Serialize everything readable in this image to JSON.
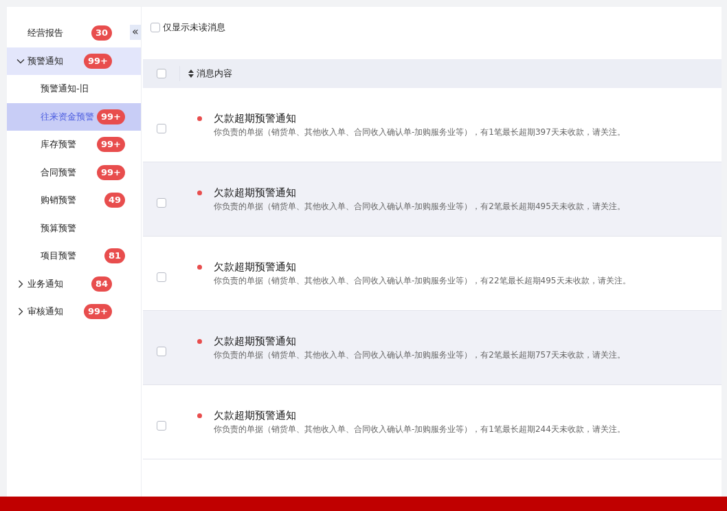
{
  "sidebar": {
    "collapse_icon": "«",
    "items": [
      {
        "kind": "leaf",
        "label": "经营报告",
        "badge": "30",
        "selected": false
      },
      {
        "kind": "group",
        "label": "预警通知",
        "badge": "99+",
        "selected": false,
        "expanded": true,
        "children": [
          {
            "label": "预警通知-旧",
            "selected": false
          },
          {
            "label": "往来资金预警",
            "badge": "99+",
            "selected": true
          },
          {
            "label": "库存预警",
            "badge": "99+",
            "selected": false
          },
          {
            "label": "合同预警",
            "badge": "99+",
            "selected": false
          },
          {
            "label": "购销预警",
            "badge": "49",
            "selected": false
          },
          {
            "label": "预算预警",
            "selected": false
          },
          {
            "label": "项目预警",
            "badge": "81",
            "selected": false
          }
        ]
      },
      {
        "kind": "group",
        "label": "业务通知",
        "badge": "84",
        "selected": false,
        "expanded": false
      },
      {
        "kind": "group",
        "label": "审核通知",
        "badge": "99+",
        "selected": false,
        "expanded": false
      }
    ]
  },
  "filter": {
    "label": "仅显示未读消息",
    "checked": false
  },
  "table": {
    "header": {
      "checked": false,
      "label": "消息内容"
    },
    "rows": [
      {
        "checked": false,
        "unread": true,
        "title": "欠款超期预警通知",
        "text": "你负责的单据（销货单、其他收入单、合同收入确认单-加购服务业等），有1笔最长超期397天未收款，请关注。"
      },
      {
        "checked": false,
        "unread": true,
        "title": "欠款超期预警通知",
        "text": "你负责的单据（销货单、其他收入单、合同收入确认单-加购服务业等），有2笔最长超期495天未收款，请关注。"
      },
      {
        "checked": false,
        "unread": true,
        "title": "欠款超期预警通知",
        "text": "你负责的单据（销货单、其他收入单、合同收入确认单-加购服务业等），有22笔最长超期495天未收款，请关注。"
      },
      {
        "checked": false,
        "unread": true,
        "title": "欠款超期预警通知",
        "text": "你负责的单据（销货单、其他收入单、合同收入确认单-加购服务业等），有2笔最长超期757天未收款，请关注。"
      },
      {
        "checked": false,
        "unread": true,
        "title": "欠款超期预警通知",
        "text": "你负责的单据（销货单、其他收入单、合同收入确认单-加购服务业等），有1笔最长超期244天未收款，请关注。"
      }
    ]
  }
}
